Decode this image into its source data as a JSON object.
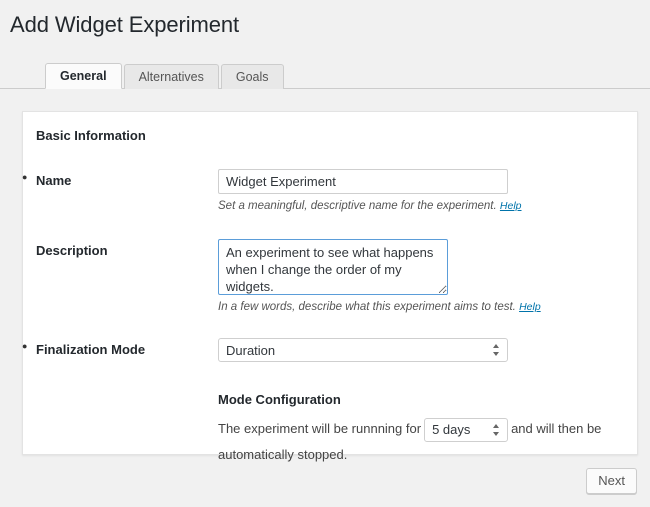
{
  "page": {
    "title": "Add Widget Experiment"
  },
  "tabs": [
    {
      "label": "General",
      "active": true
    },
    {
      "label": "Alternatives",
      "active": false
    },
    {
      "label": "Goals",
      "active": false
    }
  ],
  "panel": {
    "section_title": "Basic Information",
    "fields": {
      "name": {
        "label": "Name",
        "required": true,
        "value": "Widget Experiment",
        "placeholder": "",
        "help_text": "Set a meaningful, descriptive name for the experiment.",
        "help_link": "Help"
      },
      "description": {
        "label": "Description",
        "required": false,
        "value": "An experiment to see what happens when I change the order of my widgets.",
        "placeholder": "",
        "help_text": "In a few words, describe what this experiment aims to test.",
        "help_link": "Help"
      },
      "finalization_mode": {
        "label": "Finalization Mode",
        "required": true,
        "selected": "Duration",
        "options": [
          "Duration"
        ]
      }
    },
    "mode_configuration": {
      "title": "Mode Configuration",
      "text_before": "The experiment will be runnning for",
      "duration_selected": "5 days",
      "duration_options": [
        "5 days"
      ],
      "text_after": "and will then be automatically stopped."
    }
  },
  "footer": {
    "next_label": "Next"
  },
  "colors": {
    "page_background": "#f1f1f1",
    "panel_background": "#ffffff",
    "link_blue": "#0073aa",
    "focus_border": "#5b9dd9",
    "title_text": "#23282d"
  }
}
